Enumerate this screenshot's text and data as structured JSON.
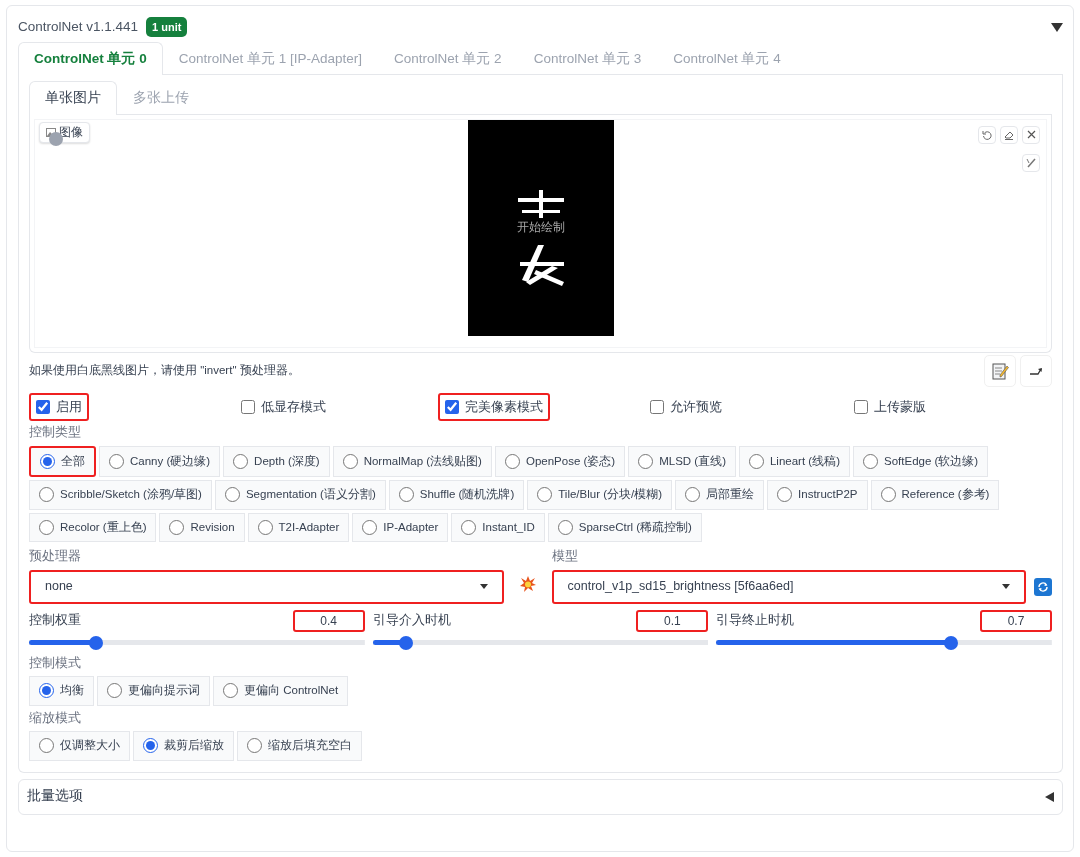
{
  "header": {
    "title": "ControlNet v1.1.441",
    "badge": "1 unit",
    "expanded": true
  },
  "unit_tabs": [
    {
      "label": "ControlNet 单元 0",
      "selected": true
    },
    {
      "label": "ControlNet 单元 1 [IP-Adapter]",
      "selected": false
    },
    {
      "label": "ControlNet 单元 2",
      "selected": false
    },
    {
      "label": "ControlNet 单元 3",
      "selected": false
    },
    {
      "label": "ControlNet 单元 4",
      "selected": false
    }
  ],
  "image_tabs": [
    {
      "label": "单张图片",
      "selected": true
    },
    {
      "label": "多张上传",
      "selected": false
    }
  ],
  "image_panel": {
    "label": "图像",
    "overlay": "开始绘制"
  },
  "hint": "如果使用白底黑线图片，请使用 \"invert\" 预处理器。",
  "options": [
    {
      "label": "启用",
      "checked": true,
      "highlighted": true
    },
    {
      "label": "低显存模式",
      "checked": false,
      "highlighted": false
    },
    {
      "label": "完美像素模式",
      "checked": true,
      "highlighted": true
    },
    {
      "label": "允许预览",
      "checked": false,
      "highlighted": false
    },
    {
      "label": "上传蒙版",
      "checked": false,
      "highlighted": false
    }
  ],
  "control_type": {
    "label": "控制类型",
    "lines": [
      {
        "options": [
          {
            "label": "全部",
            "selected": true,
            "highlighted": true
          },
          {
            "label": "Canny (硬边缘)",
            "selected": false,
            "highlighted": false
          },
          {
            "label": "Depth (深度)",
            "selected": false,
            "highlighted": false
          },
          {
            "label": "NormalMap (法线贴图)",
            "selected": false,
            "highlighted": false
          },
          {
            "label": "OpenPose (姿态)",
            "selected": false,
            "highlighted": false
          },
          {
            "label": "MLSD (直线)",
            "selected": false,
            "highlighted": false
          },
          {
            "label": "Lineart (线稿)",
            "selected": false,
            "highlighted": false
          },
          {
            "label": "SoftEdge (软边缘)",
            "selected": false,
            "highlighted": false
          }
        ]
      },
      {
        "options": [
          {
            "label": "Scribble/Sketch (涂鸦/草图)",
            "selected": false,
            "highlighted": false
          },
          {
            "label": "Segmentation (语义分割)",
            "selected": false,
            "highlighted": false
          },
          {
            "label": "Shuffle (随机洗牌)",
            "selected": false,
            "highlighted": false
          },
          {
            "label": "Tile/Blur (分块/模糊)",
            "selected": false,
            "highlighted": false
          },
          {
            "label": "局部重绘",
            "selected": false,
            "highlighted": false
          },
          {
            "label": "InstructP2P",
            "selected": false,
            "highlighted": false
          },
          {
            "label": "Reference (参考)",
            "selected": false,
            "highlighted": false
          }
        ]
      },
      {
        "options": [
          {
            "label": "Recolor (重上色)",
            "selected": false,
            "highlighted": false
          },
          {
            "label": "Revision",
            "selected": false,
            "highlighted": false
          },
          {
            "label": "T2I-Adapter",
            "selected": false,
            "highlighted": false
          },
          {
            "label": "IP-Adapter",
            "selected": false,
            "highlighted": false
          },
          {
            "label": "Instant_ID",
            "selected": false,
            "highlighted": false
          },
          {
            "label": "SparseCtrl (稀疏控制)",
            "selected": false,
            "highlighted": false
          }
        ]
      }
    ]
  },
  "preprocessor": {
    "label": "预处理器",
    "value": "none",
    "highlighted": true
  },
  "model": {
    "label": "模型",
    "value": "control_v1p_sd15_brightness [5f6aa6ed]",
    "highlighted": true
  },
  "sliders": [
    {
      "label": "控制权重",
      "reading": "0.4",
      "level": 0.2,
      "highlighted": true
    },
    {
      "label": "引导介入时机",
      "reading": "0.1",
      "level": 0.1,
      "highlighted": true
    },
    {
      "label": "引导终止时机",
      "reading": "0.7",
      "level": 0.7,
      "highlighted": true
    }
  ],
  "control_mode": {
    "label": "控制模式",
    "options": [
      {
        "label": "均衡",
        "selected": true
      },
      {
        "label": "更偏向提示词",
        "selected": false
      },
      {
        "label": "更偏向 ControlNet",
        "selected": false
      }
    ]
  },
  "resize_mode": {
    "label": "缩放模式",
    "options": [
      {
        "label": "仅调整大小",
        "selected": false
      },
      {
        "label": "裁剪后缩放",
        "selected": true
      },
      {
        "label": "缩放后填充空白",
        "selected": false
      }
    ]
  },
  "batch": {
    "label": "批量选项",
    "expanded": false
  }
}
